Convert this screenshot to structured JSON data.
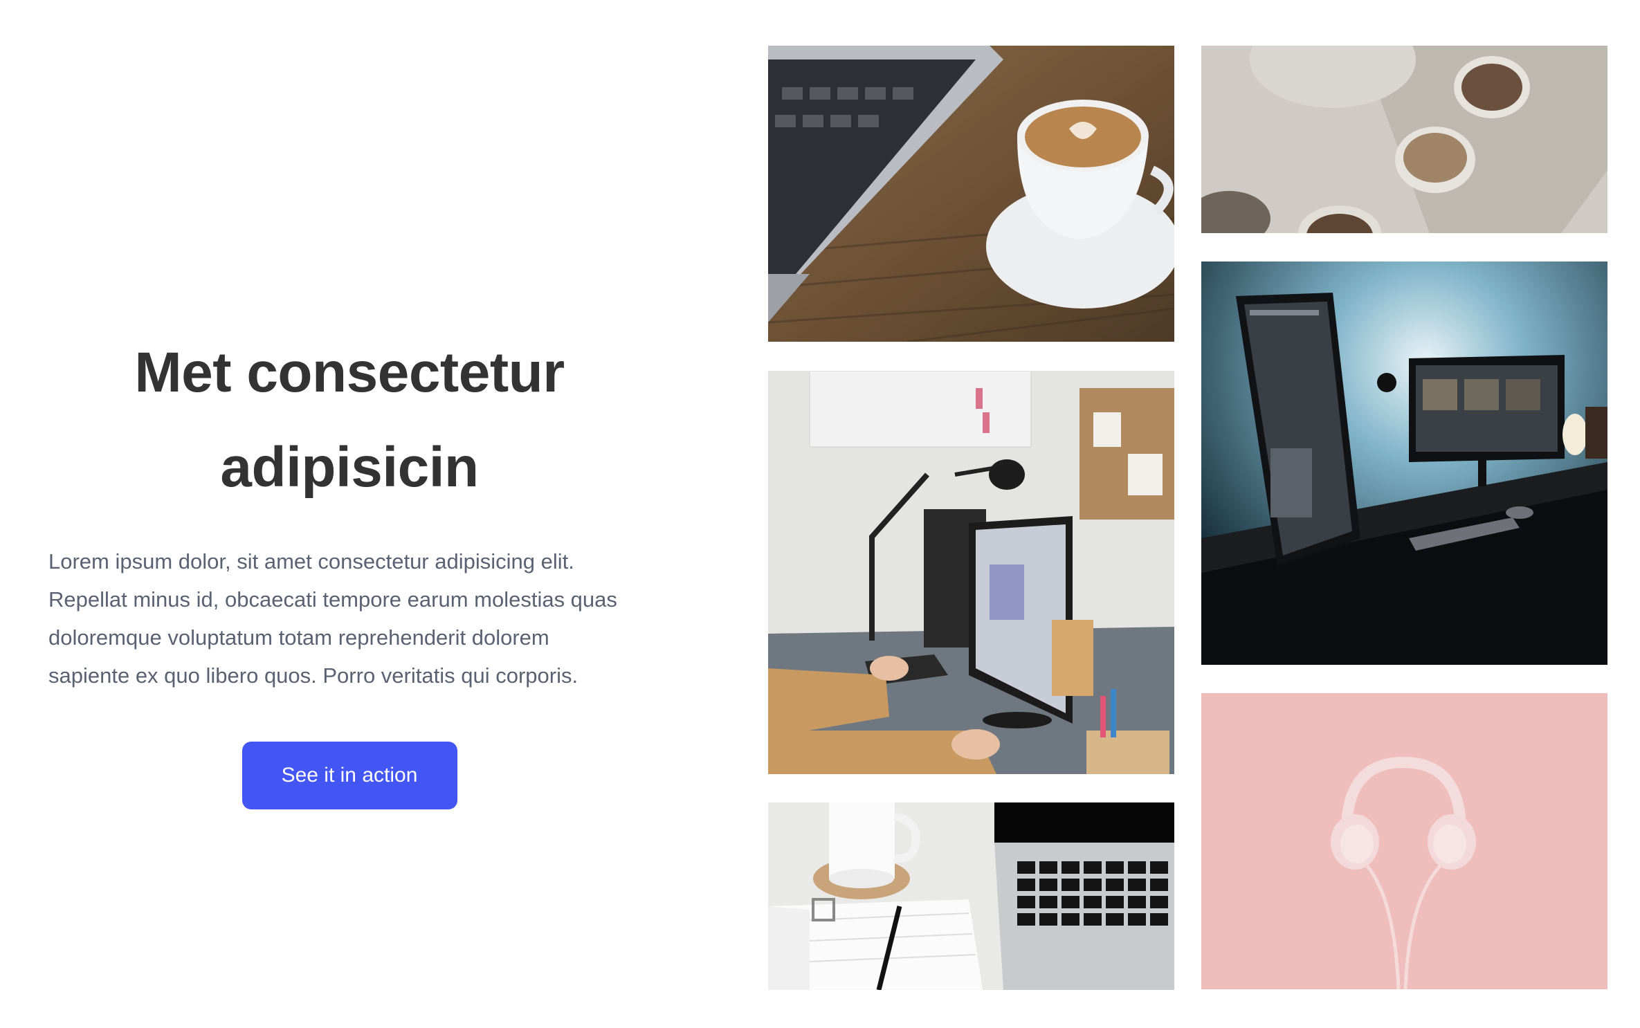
{
  "hero": {
    "title_line_1": "Met consectetur",
    "title_line_2": "adipisicin",
    "body_line_1": "Lorem ipsum dolor, sit amet consectetur adipisicing elit.",
    "body_line_2": "Repellat minus id, obcaecati tempore earum molestias quas",
    "body_line_3": "doloremque voluptatum totam reprehenderit dolorem",
    "body_line_4": "sapiente ex quo libero quos. Porro veritatis qui corporis.",
    "cta_label": "See it in action"
  },
  "gallery": {
    "images": [
      "photo-laptop-latte",
      "photo-coffee-cups",
      "photo-office-desk-monitor",
      "photo-dual-monitor-setup",
      "photo-mug-notebook-laptop",
      "photo-pink-headphones"
    ]
  },
  "colors": {
    "accent": "#4356f4",
    "heading": "#333333",
    "body": "#5a6272",
    "background": "#ffffff"
  }
}
